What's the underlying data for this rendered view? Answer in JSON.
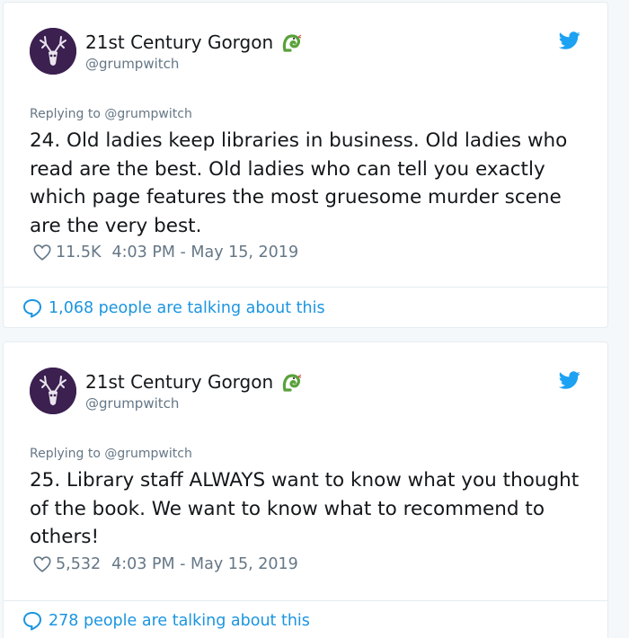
{
  "tweets": [
    {
      "author": {
        "display_name": "21st Century Gorgon",
        "handle": "@grumpwitch",
        "name_emoji": "snake-icon"
      },
      "replying_to": "Replying to @grumpwitch",
      "text": "24. Old ladies keep libraries in business. Old ladies who read are the best. Old ladies who can tell you exactly which page features the most gruesome murder scene are the very best.",
      "likes": "11.5K",
      "timestamp": "4:03 PM - May 15, 2019",
      "talking": "1,068 people are talking about this"
    },
    {
      "author": {
        "display_name": "21st Century Gorgon",
        "handle": "@grumpwitch",
        "name_emoji": "snake-icon"
      },
      "replying_to": "Replying to @grumpwitch",
      "text": "25. Library staff ALWAYS want to know what you thought of the book. We want to know what to recommend to others!",
      "likes": "5,532",
      "timestamp": "4:03 PM - May 15, 2019",
      "talking": "278 people are talking about this"
    }
  ],
  "colors": {
    "link_blue": "#1b95e0",
    "twitter_blue": "#1da1f2",
    "muted": "#657786",
    "text": "#14171a",
    "avatar_bg": "#3b2050",
    "emoji_green": "#5aa13a"
  }
}
